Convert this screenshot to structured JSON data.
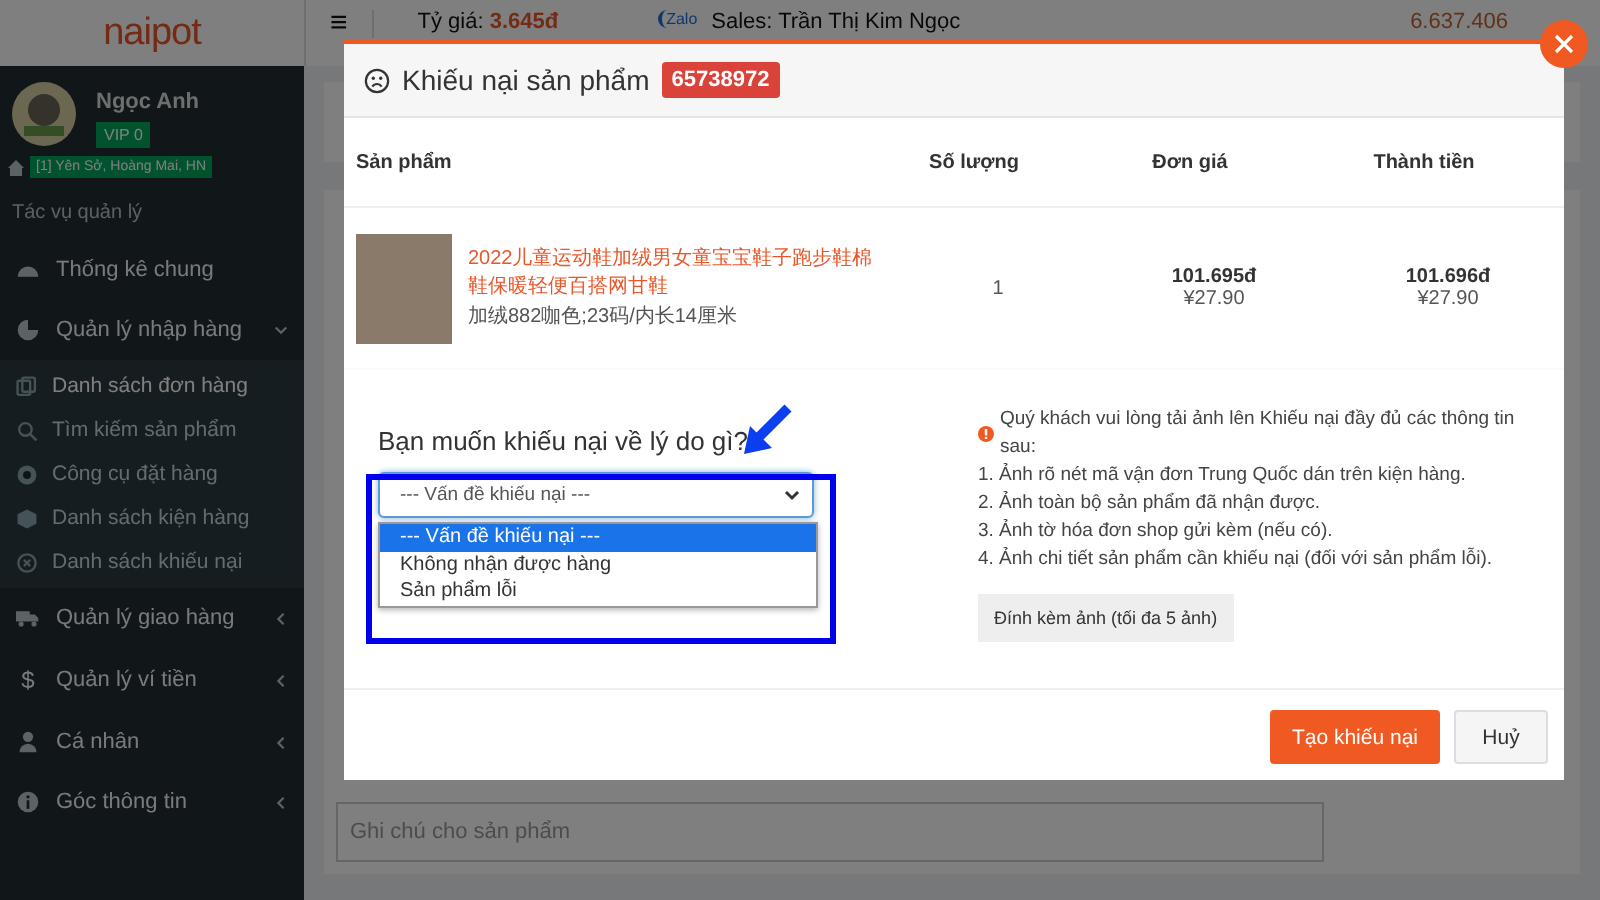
{
  "header": {
    "logo": "naipot",
    "menu_glyph": "≡",
    "rate_label": "Tỷ giá:",
    "rate_value": "3.645đ",
    "zalo": "Zalo",
    "sales": "Sales: Trần Thị Kim Ngọc",
    "balance": "6.637.406"
  },
  "sidebar": {
    "user": {
      "name": "Ngọc Anh",
      "badge": "VIP 0",
      "address": "[1] Yên Sở, Hoàng Mai, HN"
    },
    "section_title": "Tác vụ quản lý",
    "items": [
      {
        "label": "Thống kê chung"
      },
      {
        "label": "Quản lý nhập hàng",
        "expanded": true,
        "children": [
          {
            "label": "Danh sách đơn hàng",
            "selected": true
          },
          {
            "label": "Tìm kiếm sản phẩm",
            "selected": false
          },
          {
            "label": "Công cụ đặt hàng",
            "selected": false
          },
          {
            "label": "Danh sách kiện hàng",
            "selected": false
          },
          {
            "label": "Danh sách khiếu nại",
            "selected": false
          }
        ]
      },
      {
        "label": "Quản lý giao hàng",
        "expanded": false
      },
      {
        "label": "Quản lý ví tiền",
        "icon_glyph": "$",
        "expanded": false
      },
      {
        "label": "Cá nhân",
        "expanded": false
      },
      {
        "label": "Góc thông tin",
        "expanded": false
      }
    ]
  },
  "background": {
    "note_placeholder": "Ghi chú cho sản phẩm"
  },
  "modal": {
    "title": "Khiếu nại sản phẩm",
    "order_id": "65738972",
    "columns": [
      "Sản phẩm",
      "Số lượng",
      "Đơn giá",
      "Thành tiền"
    ],
    "product": {
      "name": "2022儿童运动鞋加绒男女童宝宝鞋子跑步鞋棉鞋保暖轻便百搭网甘鞋",
      "variant": "加绒882咖色;23码/内长14厘米",
      "quantity": "1",
      "unit_price": "101.695đ",
      "unit_price_cny": "¥27.90",
      "total": "101.696đ",
      "total_cny": "¥27.90"
    },
    "question": "Bạn muốn khiếu nại về lý do gì?",
    "reason_select": {
      "value": "--- Vấn đề khiếu nại ---",
      "open": true,
      "options": [
        {
          "label": "--- Vấn đề khiếu nại ---",
          "selected": true
        },
        {
          "label": "Không nhận được hàng",
          "selected": false
        },
        {
          "label": "Sản phẩm lỗi",
          "selected": false
        }
      ]
    },
    "notice": "Quý khách vui lòng tải ảnh lên Khiếu nại đầy đủ các thông tin sau:",
    "notice_items": [
      "1. Ảnh rõ nét mã vận đơn Trung Quốc dán trên kiện hàng.",
      "2. Ảnh toàn bộ sản phẩm đã nhận được.",
      "3. Ảnh tờ hóa đơn shop gửi kèm (nếu có).",
      "4. Ảnh chi tiết sản phẩm cần khiếu nại (đối với sản phẩm lỗi)."
    ],
    "attach_button": "Đính kèm ảnh (tối đa 5 ảnh)",
    "buttons": [
      {
        "label": "Tạo khiếu nại",
        "kind": "primary"
      },
      {
        "label": "Huỷ",
        "kind": "default"
      }
    ]
  }
}
